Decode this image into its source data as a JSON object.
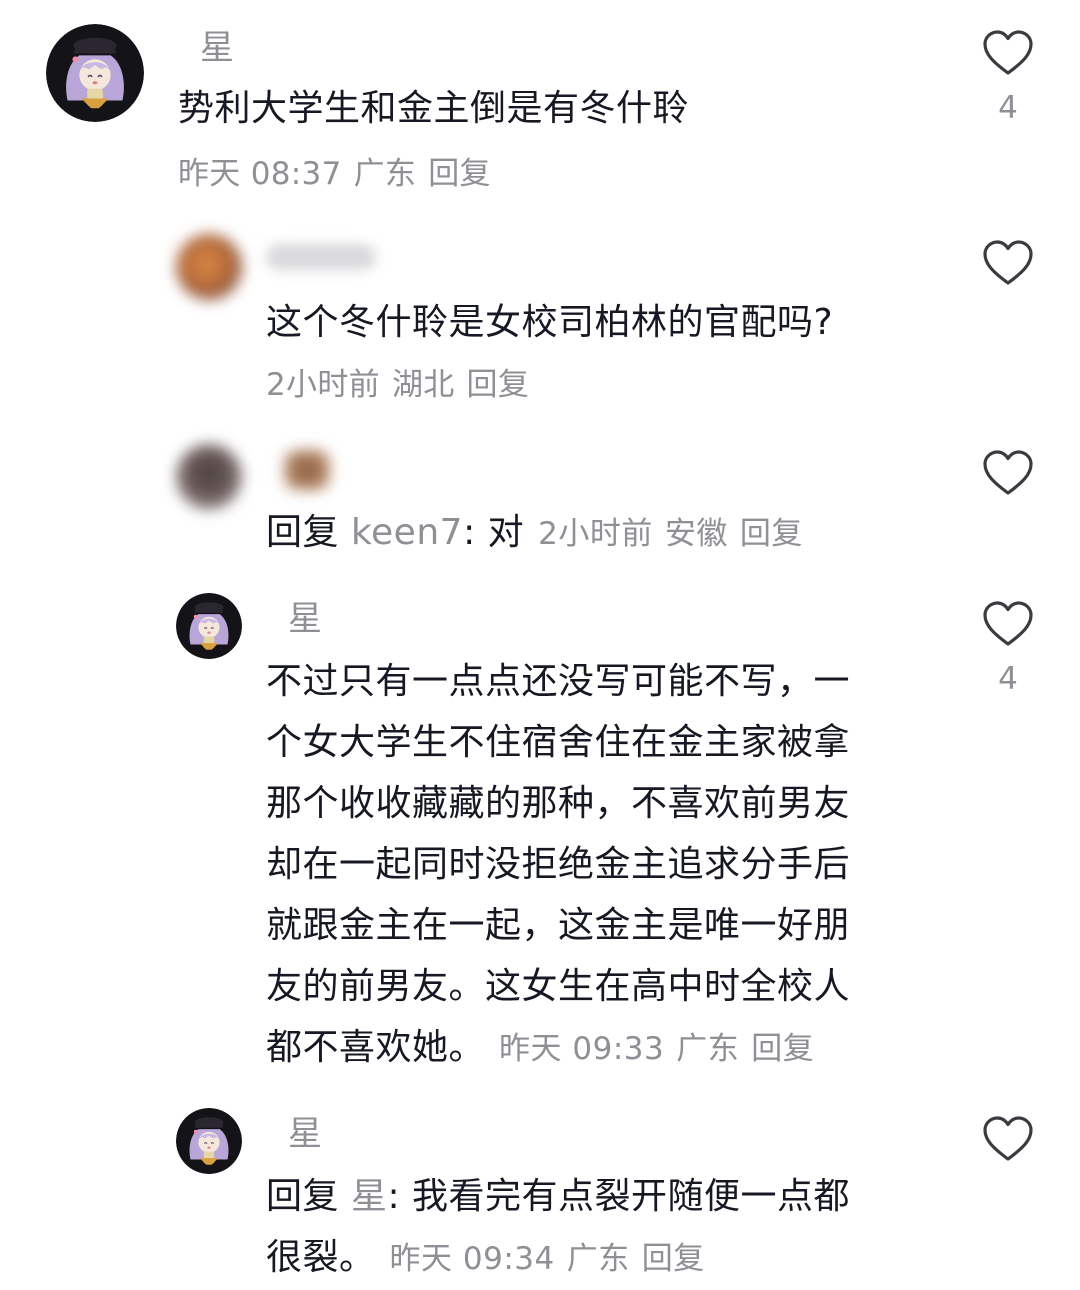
{
  "comments": [
    {
      "username": "星",
      "text": "势利大学生和金主倒是有冬什聆",
      "time": "昨天 08:37",
      "location": "广东",
      "reply_label": "回复",
      "likes": "4"
    },
    {
      "username": "",
      "text": "这个冬什聆是女校司柏林的官配吗?",
      "time": "2小时前",
      "location": "湖北",
      "reply_label": "回复",
      "likes": ""
    },
    {
      "username": "",
      "reply_prefix": "回复",
      "reply_target": "keen7",
      "text": ": 对",
      "time": "2小时前",
      "location": "安徽",
      "reply_label": "回复",
      "likes": ""
    },
    {
      "username": "星",
      "text_lines": [
        "不过只有一点点还没写可能不写，一",
        "个女大学生不住宿舍住在金主家被拿",
        "那个收收藏藏的那种，不喜欢前男友",
        "却在一起同时没拒绝金主追求分手后",
        "就跟金主在一起，这金主是唯一好朋",
        "友的前男友。这女生在高中时全校人",
        "都不喜欢她。"
      ],
      "time": "昨天 09:33",
      "location": "广东",
      "reply_label": "回复",
      "likes": "4"
    },
    {
      "username": "星",
      "reply_prefix": "回复",
      "reply_target": "星",
      "text_lines": [
        ": 我看完有点裂开随便一点都",
        "很裂。"
      ],
      "time": "昨天 09:34",
      "location": "广东",
      "reply_label": "回复",
      "likes": ""
    }
  ],
  "icons": {
    "like": "heart-outline-icon"
  },
  "colors": {
    "text": "#161823",
    "secondary": "#8f8f95",
    "background": "#ffffff"
  }
}
